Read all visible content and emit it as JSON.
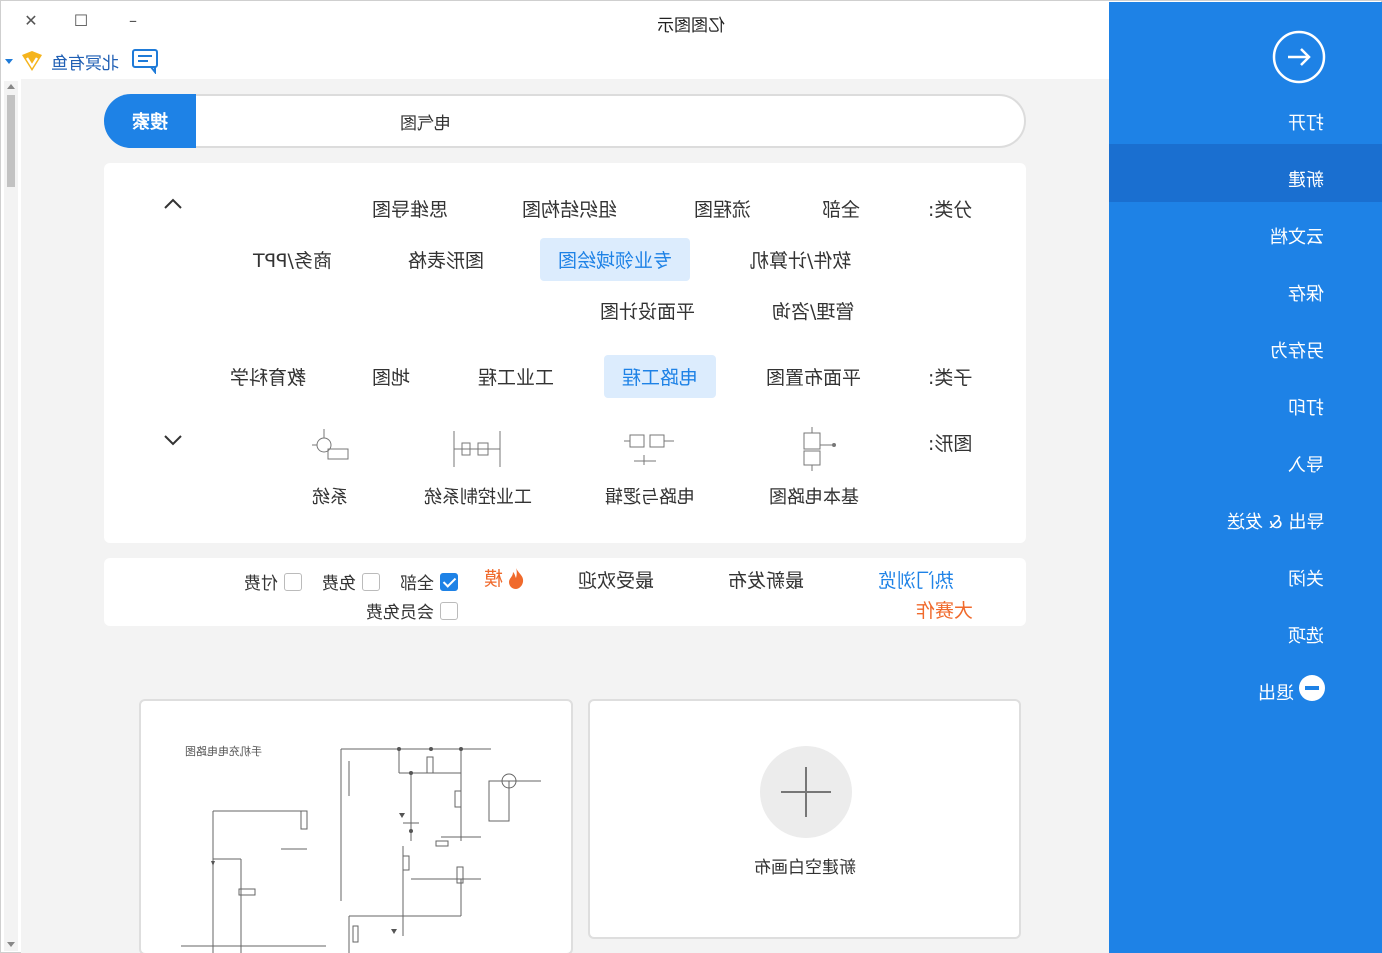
{
  "window": {
    "title": "亿图图示",
    "close_icon": "✕",
    "maximize_icon": "☐",
    "minimize_icon": "–"
  },
  "user": {
    "name": "北冥有鱼"
  },
  "search": {
    "button_label": "搜索",
    "value": "电气图"
  },
  "filters": {
    "category_label": "分类:",
    "categories": [
      "全部",
      "流程图",
      "组织结构图",
      "思维导图",
      "软件/计算机",
      "专业领域绘图",
      "图形表格",
      "商务/PPT",
      "管理/咨询",
      "平面设计图"
    ],
    "subcategory_label": "子类:",
    "subcategories": [
      "平面布置图",
      "电路工程",
      "工业工程",
      "地图",
      "教育科学"
    ],
    "shape_label": "图形:",
    "shapes": [
      "基本电路图",
      "电路与逻辑",
      "工业控制系统",
      "系统"
    ]
  },
  "sortbar": {
    "sort_options": [
      "热门浏览",
      "最新发布",
      "最受欢迎"
    ],
    "contest": "大赛作",
    "hot": "模",
    "checks": [
      {
        "label": "全部",
        "checked": true
      },
      {
        "label": "免费",
        "checked": false
      },
      {
        "label": "付费",
        "checked": false
      },
      {
        "label": "会员免费",
        "checked": false
      }
    ]
  },
  "cards": {
    "blank_label": "新建空白画布",
    "template_title": "手机充电电路图"
  },
  "sidebar": {
    "items": [
      "打开",
      "新建",
      "云文档",
      "保存",
      "另存为",
      "打印",
      "导入",
      "导出 & 发送",
      "关闭",
      "选项",
      "退出"
    ]
  },
  "colors": {
    "accent": "#1e82e6",
    "sidebar_selected": "#1a6fd0",
    "hot": "#f06a2c"
  }
}
